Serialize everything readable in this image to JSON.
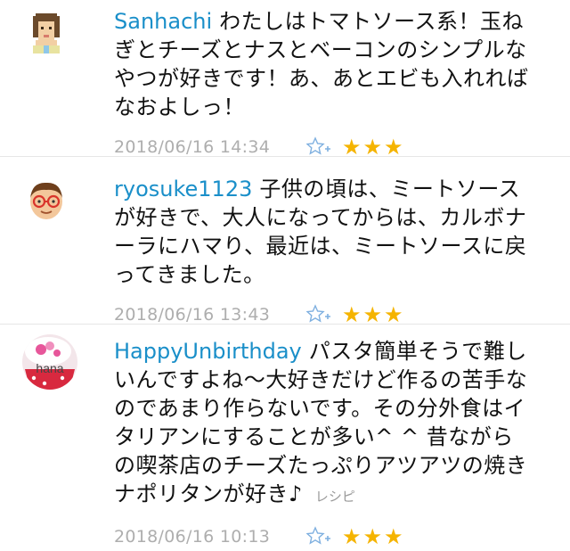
{
  "comments": [
    {
      "user": "Sanhachi",
      "text": "わたしはトマトソース系！玉ねぎとチーズとナスとベーコンのシンプルなやつが好きです！あ、あとエビも入れればなおよしっ！",
      "recipe_link": "",
      "date": "2018/06/16 14:34",
      "stars": "★★★",
      "avatar_icon": "pixel-avatar-icon"
    },
    {
      "user": "ryosuke1123",
      "text": "子供の頃は、ミートソースが好きで、大人になってからは、カルボナーラにハマり、最近は、ミートソースに戻ってきました。",
      "recipe_link": "",
      "date": "2018/06/16 13:43",
      "stars": "★★★",
      "avatar_icon": "glasses-avatar-icon"
    },
    {
      "user": "HappyUnbirthday",
      "text": "パスタ簡単そうで難しいんですよね〜大好きだけど作るの苦手なのであまり作らないです。その分外食はイタリアンにすることが多い^ ^ 昔ながらの喫茶店のチーズたっぷりアツアツの焼きナポリタンが好き♪",
      "recipe_link": "レシピ",
      "date": "2018/06/16 10:13",
      "stars": "★★★",
      "avatar_icon": "cupcake-avatar-icon"
    }
  ],
  "avatar3_label": "hana",
  "colors": {
    "username": "#1a8fc9",
    "star": "#f5b400",
    "meta": "#aeaeae"
  }
}
